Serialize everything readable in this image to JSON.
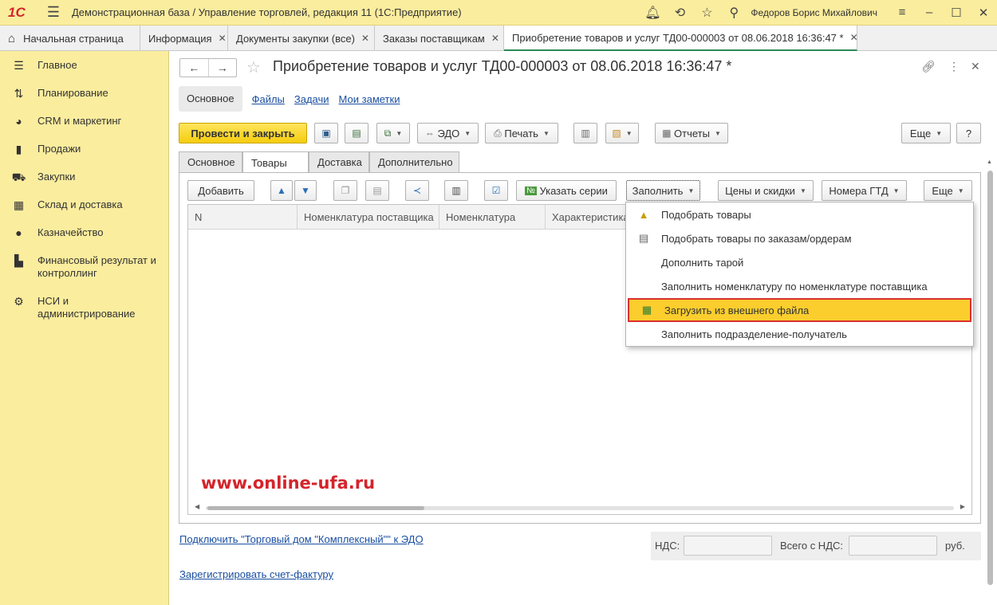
{
  "titlebar": {
    "logo": "1С",
    "title": "Демонстрационная база / Управление торговлей, редакция 11  (1С:Предприятие)",
    "user": "Федоров Борис Михайлович"
  },
  "tabs": [
    {
      "label": "Начальная страница"
    },
    {
      "label": "Информация"
    },
    {
      "label": "Документы закупки (все)"
    },
    {
      "label": "Заказы поставщикам"
    },
    {
      "label": "Приобретение товаров и услуг ТД00-000003 от 08.06.2018 16:36:47 *"
    }
  ],
  "sidebar": {
    "items": [
      {
        "icon": "menu-lines-icon",
        "label": "Главное"
      },
      {
        "icon": "planning-icon",
        "label": "Планирование"
      },
      {
        "icon": "pie-icon",
        "label": "CRM и маркетинг"
      },
      {
        "icon": "bag-icon",
        "label": "Продажи"
      },
      {
        "icon": "cart-icon",
        "label": "Закупки"
      },
      {
        "icon": "warehouse-icon",
        "label": "Склад и доставка"
      },
      {
        "icon": "coin-icon",
        "label": "Казначейство"
      },
      {
        "icon": "bar-chart-icon",
        "label": "Финансовый результат и",
        "label2": "контроллинг"
      },
      {
        "icon": "gear-icon",
        "label": "НСИ и",
        "label2": "администрирование"
      }
    ]
  },
  "document": {
    "title": "Приобретение товаров и услуг ТД00-000003 от 08.06.2018 16:36:47 *",
    "subnav": {
      "current": "Основное",
      "links": [
        "Файлы",
        "Задачи",
        "Мои заметки"
      ]
    },
    "toolbar": {
      "post_close": "Провести и закрыть",
      "edo": "ЭДО",
      "print": "Печать",
      "reports": "Отчеты",
      "more": "Еще",
      "help": "?"
    },
    "inner_tabs": [
      "Основное",
      "Товары",
      "Доставка",
      "Дополнительно"
    ],
    "goods_toolbar": {
      "add": "Добавить",
      "series": "Указать серии",
      "fill": "Заполнить",
      "prices": "Цены и скидки",
      "gtd": "Номера ГТД",
      "more": "Еще"
    },
    "columns": [
      "N",
      "Номенклатура поставщика",
      "Номенклатура",
      "Характеристика"
    ]
  },
  "fill_menu": {
    "items": [
      {
        "label": "Подобрать товары",
        "icon": "pick-goods-icon"
      },
      {
        "label": "Подобрать товары по заказам/ордерам",
        "icon": "pick-orders-icon"
      },
      {
        "label": "Дополнить тарой",
        "icon": ""
      },
      {
        "label": "Заполнить номенклатуру по номенклатуре поставщика",
        "icon": ""
      },
      {
        "label": "Загрузить из внешнего файла",
        "icon": "load-file-icon"
      },
      {
        "label": "Заполнить подразделение-получатель",
        "icon": ""
      }
    ]
  },
  "watermark": "www.online-ufa.ru",
  "footer": {
    "edo_link": "Подключить \"Торговый дом \"Комплексный\"\" к ЭДО",
    "invoice_link": "Зарегистрировать счет-фактуру",
    "vat_label": "НДС:",
    "total_label": "Всего с НДС:",
    "currency": "руб."
  },
  "colors": {
    "sidebar_bg": "#fbed9e",
    "primary_button": "#f5cd0e",
    "highlight": "#fbcd2d",
    "highlight_border": "#d93030",
    "link": "#1a4fa0",
    "watermark": "#d4242b"
  }
}
